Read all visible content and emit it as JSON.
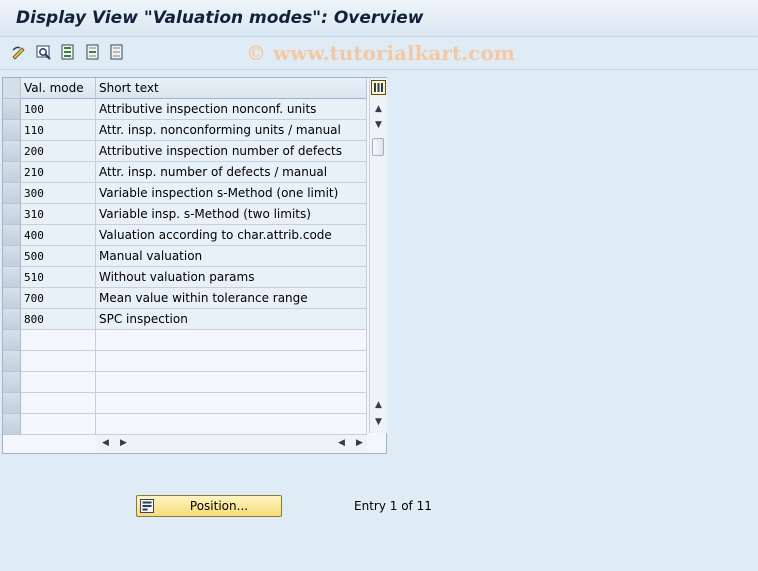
{
  "window": {
    "title": "Display View \"Valuation modes\": Overview"
  },
  "watermark": "© www.tutorialkart.com",
  "toolbar": {
    "buttons": [
      {
        "name": "display-change-icon"
      },
      {
        "name": "find-icon"
      },
      {
        "name": "select-all-icon"
      },
      {
        "name": "select-block-icon"
      },
      {
        "name": "deselect-all-icon"
      }
    ]
  },
  "table": {
    "headers": {
      "mode": "Val. mode",
      "text": "Short text"
    },
    "rows": [
      {
        "mode": "100",
        "text": "Attributive inspection nonconf. units"
      },
      {
        "mode": "110",
        "text": "Attr. insp. nonconforming units / manual"
      },
      {
        "mode": "200",
        "text": "Attributive inspection number of defects"
      },
      {
        "mode": "210",
        "text": "Attr. insp. number of defects / manual"
      },
      {
        "mode": "300",
        "text": "Variable inspection s-Method (one limit)"
      },
      {
        "mode": "310",
        "text": "Variable insp. s-Method (two limits)"
      },
      {
        "mode": "400",
        "text": "Valuation according to char.attrib.code"
      },
      {
        "mode": "500",
        "text": "Manual valuation"
      },
      {
        "mode": "510",
        "text": "Without valuation params"
      },
      {
        "mode": "700",
        "text": "Mean value within tolerance range"
      },
      {
        "mode": "800",
        "text": "SPC inspection"
      }
    ],
    "empty_rows": 5
  },
  "footer": {
    "position_label": "Position...",
    "entry_text": "Entry 1 of 11"
  },
  "colors": {
    "accent_button": "#f6dc78",
    "row_fill": "#e8f0f8",
    "background": "#dfebf5"
  }
}
